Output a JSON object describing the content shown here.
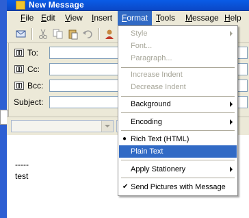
{
  "window": {
    "title": "New Message"
  },
  "menubar": {
    "items": [
      {
        "label": "File",
        "u": "F",
        "rest": "ile"
      },
      {
        "label": "Edit",
        "u": "E",
        "rest": "dit"
      },
      {
        "label": "View",
        "u": "V",
        "rest": "iew"
      },
      {
        "label": "Insert",
        "u": "I",
        "rest": "nsert"
      },
      {
        "label": "Format",
        "u": "F",
        "rest": "ormat"
      },
      {
        "label": "Tools",
        "u": "T",
        "rest": "ools"
      },
      {
        "label": "Message",
        "u": "M",
        "rest": "essage"
      },
      {
        "label": "Help",
        "u": "H",
        "rest": "elp"
      }
    ],
    "active": "Format"
  },
  "fields": {
    "to": "To:",
    "cc": "Cc:",
    "bcc": "Bcc:",
    "subject": "Subject:"
  },
  "body": {
    "separator": "-----",
    "text": "test"
  },
  "format_menu": {
    "items": [
      {
        "label": "Style",
        "disabled": true,
        "submenu": true
      },
      {
        "label": "Font...",
        "disabled": true
      },
      {
        "label": "Paragraph...",
        "disabled": true
      },
      {
        "label": "Increase Indent",
        "disabled": true
      },
      {
        "label": "Decrease Indent",
        "disabled": true
      },
      {
        "label": "Background",
        "submenu": true
      },
      {
        "label": "Encoding",
        "submenu": true
      },
      {
        "label": "Rich Text (HTML)",
        "mark": "bullet"
      },
      {
        "label": "Plain Text",
        "highlighted": true
      },
      {
        "label": "Apply Stationery",
        "submenu": true
      },
      {
        "label": "Send Pictures with Message",
        "mark": "check"
      }
    ]
  },
  "colors": {
    "titlebar": "#0b53d9",
    "highlight": "#316ac5",
    "disabled_text": "#a7a699"
  }
}
